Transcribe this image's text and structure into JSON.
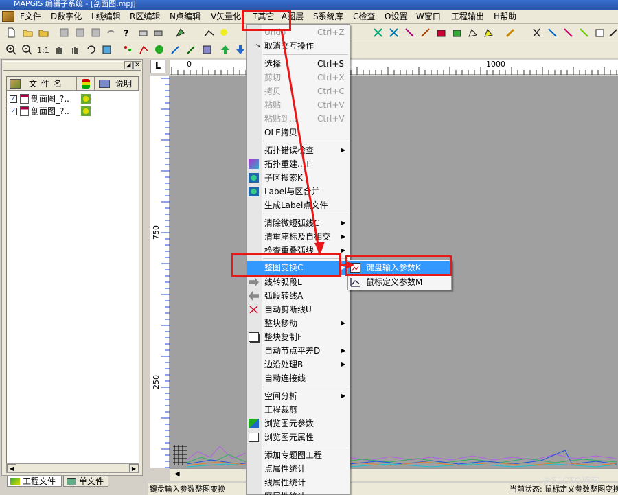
{
  "window": {
    "title": "MAPGIS 编辑子系统 - [剖面图.mpj]"
  },
  "menubar": {
    "items": [
      {
        "key": "file",
        "label": "F文件"
      },
      {
        "key": "digitize",
        "label": "D数字化"
      },
      {
        "key": "line_edit",
        "label": "L线编辑"
      },
      {
        "key": "region_edit",
        "label": "R区编辑"
      },
      {
        "key": "point_edit",
        "label": "N点编辑"
      },
      {
        "key": "vectorize",
        "label": "V矢量化"
      },
      {
        "key": "other",
        "label": "T其它"
      },
      {
        "key": "layer",
        "label": "A图层"
      },
      {
        "key": "library",
        "label": "S系统库"
      },
      {
        "key": "check",
        "label": "C检查"
      },
      {
        "key": "settings",
        "label": "O设置"
      },
      {
        "key": "window",
        "label": "W窗口"
      },
      {
        "key": "export",
        "label": "工程输出"
      },
      {
        "key": "help",
        "label": "H帮助"
      }
    ]
  },
  "left_panel": {
    "columns": {
      "name": "文件名",
      "desc": "说明"
    },
    "files": [
      {
        "name": "剖面图_?..",
        "checked": "✓"
      },
      {
        "name": "剖面图_?..",
        "checked": "✓"
      }
    ],
    "tabs": {
      "project": "工程文件",
      "single": "单文件"
    },
    "scroll_left": "◀",
    "scroll_right": "▶",
    "pin": "◢",
    "close": "✕"
  },
  "ruler": {
    "corner": "L",
    "h_labels": {
      "zero": "0",
      "thousand": "1000"
    },
    "v_labels": {
      "upper": "750",
      "lower": "250"
    }
  },
  "other_menu": {
    "items": [
      {
        "key": "undo",
        "label": "Undo",
        "shortcut": "Ctrl+Z",
        "disabled": true
      },
      {
        "key": "cancel_interactive",
        "label": "取消交互操作"
      },
      {
        "key": "select",
        "label": "选择",
        "shortcut": "Ctrl+S"
      },
      {
        "key": "cut",
        "label": "剪切",
        "shortcut": "Ctrl+X",
        "disabled": true
      },
      {
        "key": "copy",
        "label": "拷贝",
        "shortcut": "Ctrl+C",
        "disabled": true
      },
      {
        "key": "paste",
        "label": "粘贴",
        "shortcut": "Ctrl+V",
        "disabled": true
      },
      {
        "key": "paste_to",
        "label": "粘贴到...",
        "shortcut": "Ctrl+V",
        "disabled": true
      },
      {
        "key": "ole_copy",
        "label": "OLE拷贝"
      },
      {
        "key": "topo_check",
        "label": "拓扑错误检查",
        "submenu": true
      },
      {
        "key": "topo_rebuild",
        "label": "拓扑重建...T"
      },
      {
        "key": "subregion_search",
        "label": "子区搜索K"
      },
      {
        "key": "label_merge",
        "label": "Label与区合并"
      },
      {
        "key": "gen_label",
        "label": "生成Label点文件"
      },
      {
        "key": "clear_micro_arc",
        "label": "清除微短弧线C",
        "submenu": true
      },
      {
        "key": "clear_coords",
        "label": "清重座标及自相交",
        "submenu": true
      },
      {
        "key": "check_overlap_arc",
        "label": "检查重叠弧线",
        "submenu": true
      },
      {
        "key": "whole_transform",
        "label": "整图变换C",
        "submenu": true,
        "highlighted": true
      },
      {
        "key": "line_to_arc",
        "label": "线转弧段L"
      },
      {
        "key": "arc_to_line",
        "label": "弧段转线A"
      },
      {
        "key": "auto_cut_line",
        "label": "自动剪断线U"
      },
      {
        "key": "block_move",
        "label": "整块移动",
        "submenu": true
      },
      {
        "key": "block_copy",
        "label": "整块复制F"
      },
      {
        "key": "auto_node_balance",
        "label": "自动节点平差D",
        "submenu": true
      },
      {
        "key": "edge_process",
        "label": "边沿处理B",
        "submenu": true
      },
      {
        "key": "auto_connect",
        "label": "自动连接线"
      },
      {
        "key": "spatial_analysis",
        "label": "空间分析",
        "submenu": true
      },
      {
        "key": "project_clip",
        "label": "工程裁剪"
      },
      {
        "key": "browse_params",
        "label": "浏览图元参数"
      },
      {
        "key": "browse_attrs",
        "label": "浏览图元属性"
      },
      {
        "key": "add_thematic",
        "label": "添加专题图工程"
      },
      {
        "key": "point_stats",
        "label": "点属性统计"
      },
      {
        "key": "line_stats",
        "label": "线属性统计"
      },
      {
        "key": "region_stats",
        "label": "区属性统计"
      }
    ]
  },
  "transform_submenu": {
    "items": [
      {
        "key": "keyboard_params",
        "label": "键盘输入参数K",
        "highlighted": true
      },
      {
        "key": "mouse_params",
        "label": "鼠标定义参数M"
      }
    ]
  },
  "statusbar": {
    "left": "键盘输入参数整图变换",
    "right": "当前状态: 鼠标定义参数整图变换"
  },
  "watermark": "@51CTO博客",
  "colors": {
    "highlight": "#3399ff",
    "annotation": "#e81818",
    "canvas": "#a0a0a0"
  }
}
